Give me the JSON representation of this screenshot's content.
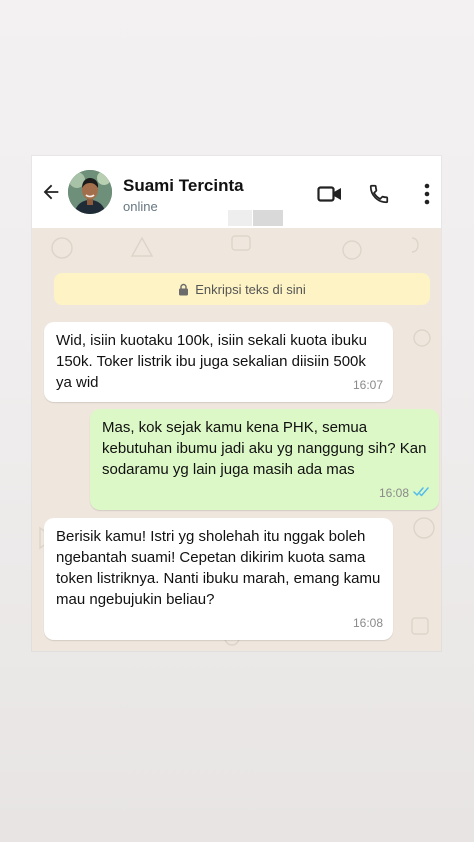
{
  "header": {
    "contact_name": "Suami Tercinta",
    "status": "online",
    "icons": [
      "back-arrow-icon",
      "video-call-icon",
      "phone-icon",
      "more-vertical-icon"
    ]
  },
  "notice": {
    "text": "Enkripsi teks di sini",
    "icon": "lock-icon"
  },
  "messages": [
    {
      "direction": "incoming",
      "text": "Wid, isiin kuotaku 100k, isiin sekali kuota ibuku 150k. Toker listrik ibu juga sekalian diisiin 500k ya wid",
      "time": "16:07"
    },
    {
      "direction": "outgoing",
      "text": "Mas, kok sejak kamu kena PHK, semua kebutuhan ibumu jadi aku yg nanggung sih? Kan sodaramu yg lain juga masih ada mas",
      "time": "16:08",
      "status": "read"
    },
    {
      "direction": "incoming",
      "text": "Berisik kamu! Istri yg sholehah itu nggak boleh ngebantah suami! Cepetan dikirim kuota sama token listriknya. Nanti ibuku marah, emang kamu mau ngebujukin beliau?",
      "time": "16:08"
    }
  ],
  "colors": {
    "chat_background": "#efe7de",
    "outgoing_bubble": "#dcf8c6",
    "incoming_bubble": "#ffffff",
    "notice_background": "#fdf3c5",
    "read_ticks": "#53bdeb"
  }
}
